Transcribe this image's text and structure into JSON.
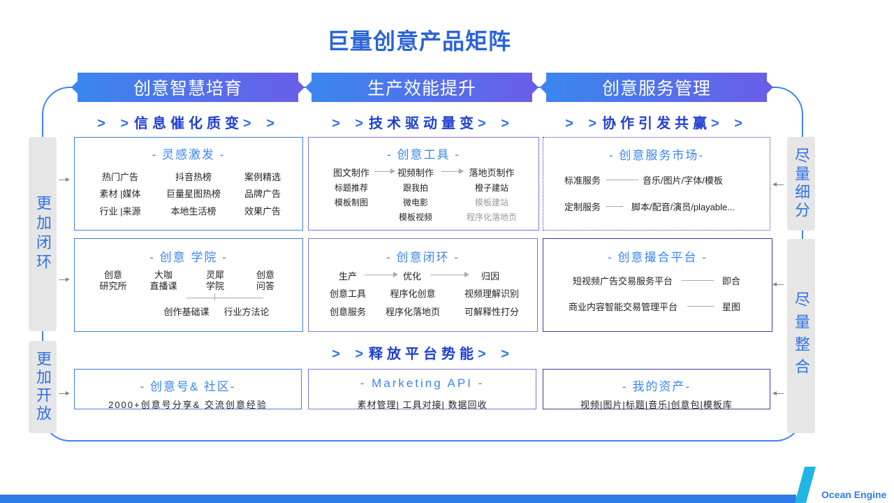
{
  "title": "巨量创意产品矩阵",
  "headers": [
    "创意智慧培育",
    "生产效能提升",
    "创意服务管理"
  ],
  "subtitles": {
    "col1": {
      "arrows_left": "> >",
      "text": "信息催化质变",
      "arrows_right": "> >"
    },
    "col2": {
      "arrows_left": "> >",
      "text": "技术驱动量变",
      "arrows_right": "> >"
    },
    "col3": {
      "arrows_left": "> >",
      "text": "协作引发共赢",
      "arrows_right": "> >"
    },
    "bottom": {
      "arrows_left": "> >",
      "text": "释放平台势能",
      "arrows_right": "> >"
    }
  },
  "sides": {
    "left_top": "更加闭环",
    "left_bottom": "更加开放",
    "right_top": "尽量细分",
    "right_bottom": "尽量整合"
  },
  "boxes": {
    "inspiration": {
      "title": "- 灵感激发 -",
      "items": [
        "热门广告",
        "抖音热榜",
        "案例精选",
        "素材 |媒体",
        "巨量星图热榜",
        "品牌广告",
        "行业 |来源",
        "本地生活榜",
        "效果广告"
      ]
    },
    "academy": {
      "title": "- 创意 学院 -",
      "items": [
        "创意\n研究所",
        "大咖\n直播课",
        "灵犀\n学院",
        "创意\n问答"
      ],
      "sub_items": [
        "创作基础课",
        "行业方法论"
      ]
    },
    "community": {
      "title": "- 创意号& 社区-",
      "desc": "2000+创意号分享& 交流创意经验"
    },
    "tools": {
      "title": "- 创意工具 -",
      "flow": [
        "图文制作",
        "视频制作",
        "落地页制作"
      ],
      "col1": [
        "标题推荐",
        "模板制图"
      ],
      "col2": [
        "跟我拍",
        "微电影",
        "模板视频"
      ],
      "col3": [
        "橙子建站",
        "模板建站",
        "程序化落地页"
      ]
    },
    "closed_loop": {
      "title": "- 创意闭环 -",
      "flow": [
        "生产",
        "优化",
        "归因"
      ],
      "col1": [
        "创意工具",
        "创意服务"
      ],
      "col2": [
        "程序化创意",
        "程序化落地页"
      ],
      "col3": [
        "视频理解识别",
        "可解释性打分"
      ]
    },
    "marketing_api": {
      "title": "- Marketing API -",
      "desc": "素材管理| 工具对接| 数据回收"
    },
    "service_market": {
      "title": "- 创意服务市场-",
      "rows": [
        {
          "label": "标准服务",
          "value": "音乐/图片/字体/模板"
        },
        {
          "label": "定制服务",
          "value": "脚本/配音/演员/playable..."
        }
      ]
    },
    "matchmaking": {
      "title": "- 创意撮合平台 -",
      "rows": [
        {
          "label": "短视频广告交易服务平台",
          "value": "即合"
        },
        {
          "label": "商业内容智能交易管理平台",
          "value": "星图"
        }
      ]
    },
    "assets": {
      "title": "- 我的资产-",
      "desc": "视频|图片|标题|音乐|创意包|模板库"
    }
  },
  "logo": {
    "text": "Ocean Engine",
    "icon": "ocean-engine-logo-icon"
  },
  "colors": {
    "accent": "#2f7be8",
    "title": "#2b64d8",
    "header_start": "#3a86ee",
    "header_end": "#6a5ee8"
  }
}
